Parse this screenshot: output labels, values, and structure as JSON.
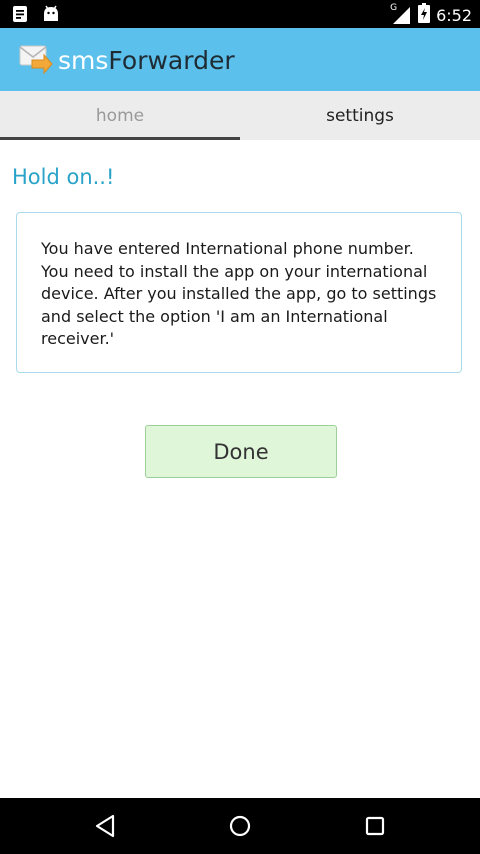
{
  "status_bar": {
    "time": "6:52",
    "network_label": "G",
    "icons": [
      "notification-doc-icon",
      "android-icon",
      "signal-icon",
      "battery-icon"
    ]
  },
  "app_bar": {
    "title_brand": "sms",
    "title_rest": "Forwarder",
    "logo_icon": "envelope-arrow-icon",
    "color": "#5bc0eb"
  },
  "tabs": [
    {
      "label": "home",
      "selected": true
    },
    {
      "label": "settings",
      "selected": false
    }
  ],
  "content": {
    "heading": "Hold on..!",
    "message": "You have entered International phone number. You need to install the app on your international device. After you installed the app, go to settings and select the option 'I am an International receiver.'",
    "done_label": "Done"
  },
  "nav_bar": {
    "icons": [
      "back-icon",
      "home-icon",
      "recents-icon"
    ]
  }
}
